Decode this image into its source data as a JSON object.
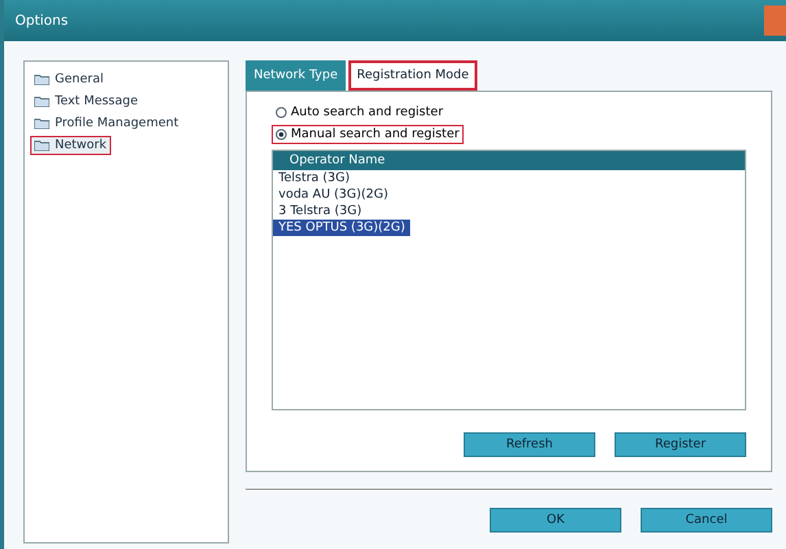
{
  "window": {
    "title": "Options"
  },
  "sidebar": {
    "items": [
      {
        "label": "General",
        "selected": false,
        "highlighted": false
      },
      {
        "label": "Text Message",
        "selected": false,
        "highlighted": false
      },
      {
        "label": "Profile Management",
        "selected": false,
        "highlighted": false
      },
      {
        "label": "Network",
        "selected": true,
        "highlighted": true
      }
    ]
  },
  "tabs": [
    {
      "label": "Network Type",
      "selected": false,
      "highlighted": false
    },
    {
      "label": "Registration Mode",
      "selected": true,
      "highlighted": true
    }
  ],
  "options": [
    {
      "label": "Auto search and register",
      "checked": false,
      "highlighted": false
    },
    {
      "label": "Manual search and register",
      "checked": true,
      "highlighted": true
    }
  ],
  "table": {
    "columns": [
      "Operator Name"
    ],
    "rows": [
      {
        "name": "Telstra (3G)",
        "selected": false
      },
      {
        "name": "voda AU (3G)(2G)",
        "selected": false
      },
      {
        "name": "3 Telstra (3G)",
        "selected": false
      },
      {
        "name": "YES OPTUS (3G)(2G)",
        "selected": true
      }
    ]
  },
  "panel_buttons": [
    "Refresh",
    "Register"
  ],
  "buttons": [
    "OK",
    "Cancel"
  ]
}
